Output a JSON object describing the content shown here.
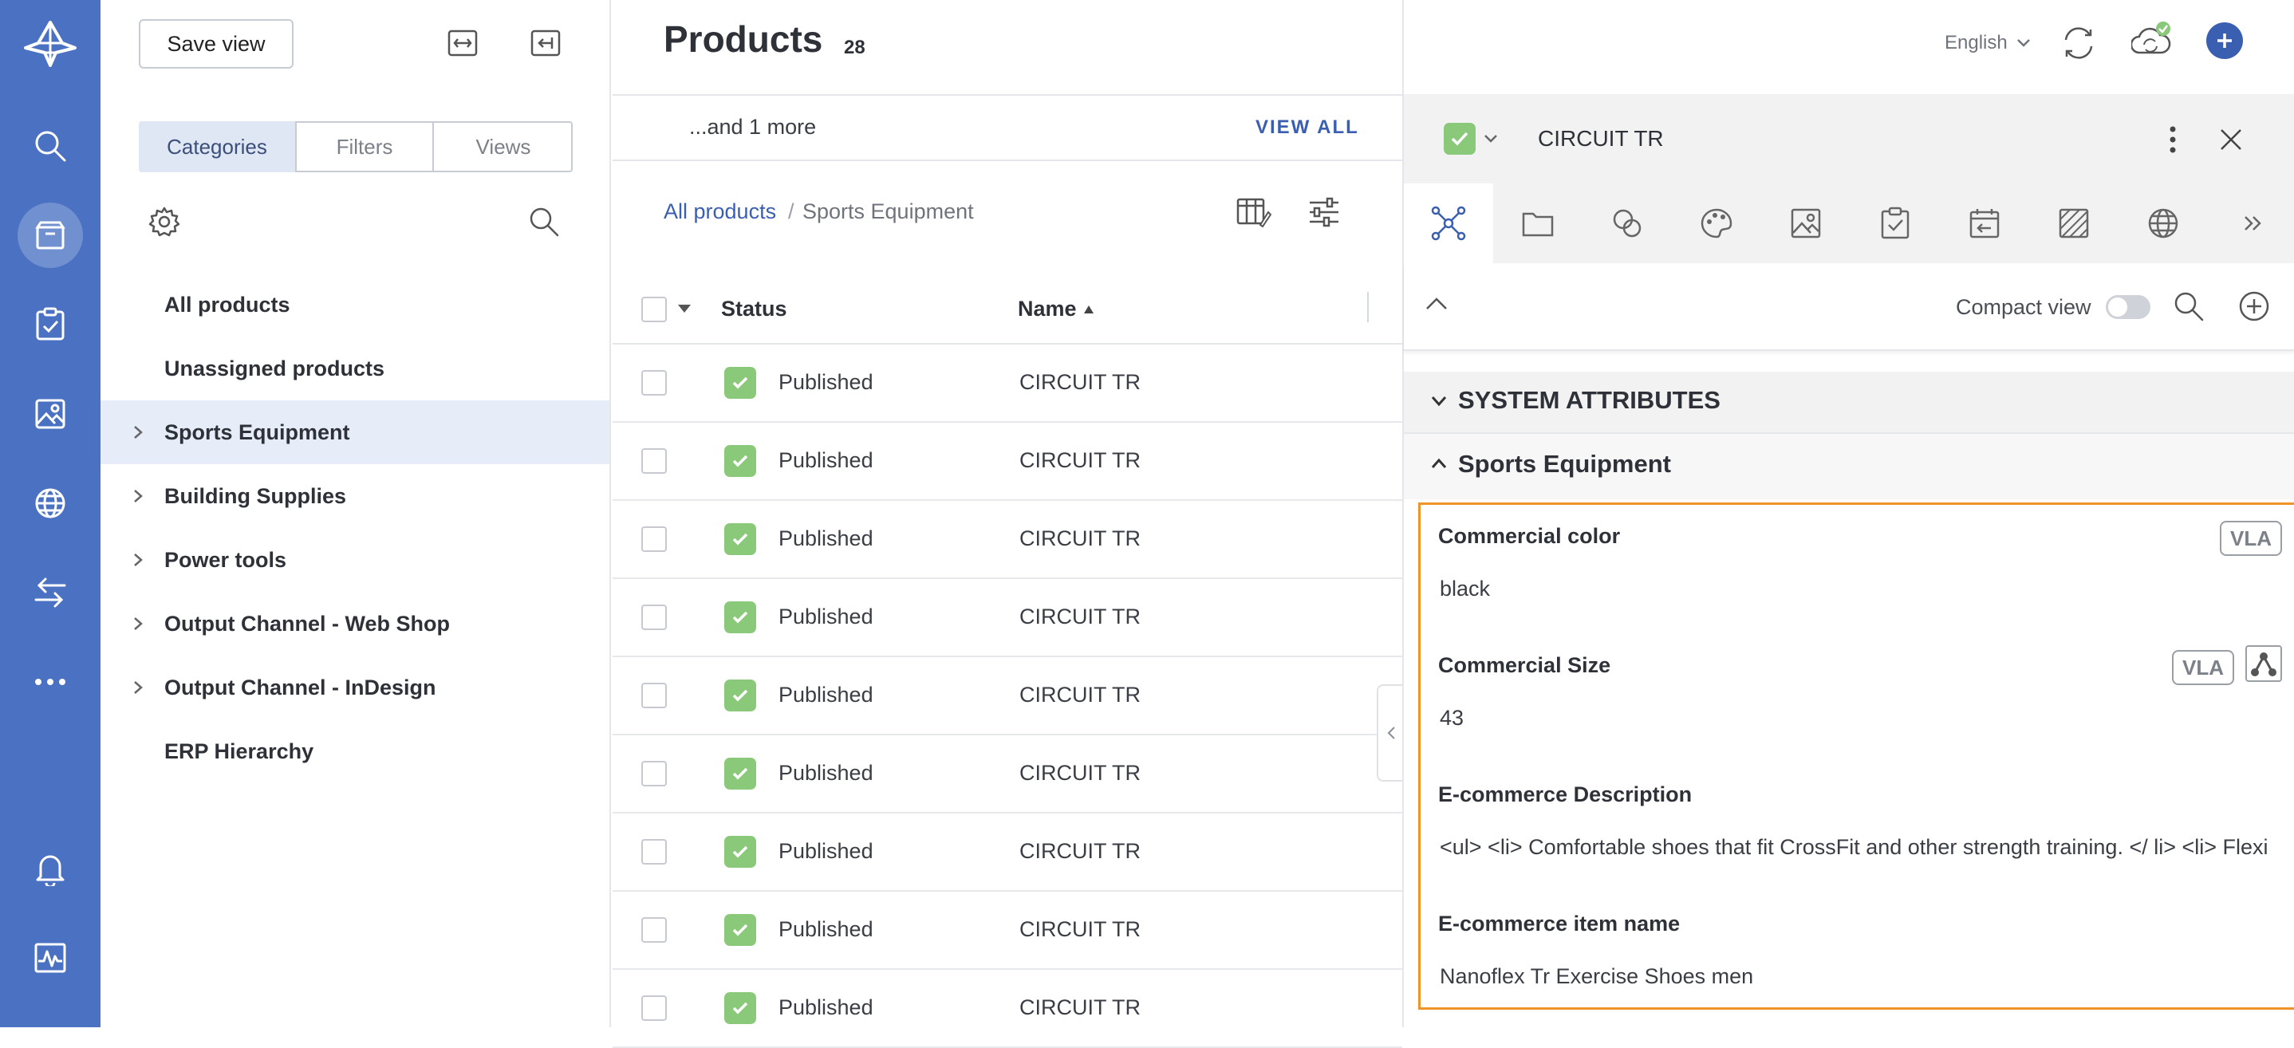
{
  "nav": {
    "items": [
      "logo-icon",
      "search-icon",
      "products-icon",
      "tasks-icon",
      "images-icon",
      "globe-icon",
      "transfer-icon",
      "more-icon",
      "bell-icon",
      "activity-icon"
    ],
    "active": "products-icon"
  },
  "catpanel": {
    "save_view": "Save view",
    "segments": [
      "Categories",
      "Filters",
      "Views"
    ],
    "active_segment": "Categories",
    "items": [
      {
        "label": "All products",
        "expandable": false
      },
      {
        "label": "Unassigned products",
        "expandable": false
      },
      {
        "label": "Sports Equipment",
        "expandable": true,
        "selected": true
      },
      {
        "label": "Building Supplies",
        "expandable": true
      },
      {
        "label": "Power tools",
        "expandable": true
      },
      {
        "label": "Output Channel - Web Shop",
        "expandable": true
      },
      {
        "label": "Output Channel - InDesign",
        "expandable": true
      },
      {
        "label": "ERP Hierarchy",
        "expandable": false
      }
    ]
  },
  "header": {
    "title": "Products",
    "count": "28",
    "language": "English"
  },
  "list": {
    "more_text": "...and 1 more",
    "view_all": "VIEW ALL",
    "breadcrumb_root": "All products",
    "breadcrumb_sep": "/",
    "breadcrumb_current": "Sports Equipment",
    "col_status": "Status",
    "col_name": "Name",
    "rows": [
      {
        "status": "Published",
        "name": "CIRCUIT TR"
      },
      {
        "status": "Published",
        "name": "CIRCUIT TR"
      },
      {
        "status": "Published",
        "name": "CIRCUIT TR"
      },
      {
        "status": "Published",
        "name": "CIRCUIT TR"
      },
      {
        "status": "Published",
        "name": "CIRCUIT TR"
      },
      {
        "status": "Published",
        "name": "CIRCUIT TR"
      },
      {
        "status": "Published",
        "name": "CIRCUIT TR"
      },
      {
        "status": "Published",
        "name": "CIRCUIT TR"
      },
      {
        "status": "Published",
        "name": "CIRCUIT TR"
      }
    ]
  },
  "detail": {
    "title": "CIRCUIT TR",
    "compact_view": "Compact view",
    "compact_view_on": false,
    "section_system": "SYSTEM ATTRIBUTES",
    "section_sports": "Sports Equipment",
    "attributes": [
      {
        "label": "Commercial color",
        "value": "black",
        "badges": [
          "VLA"
        ]
      },
      {
        "label": "Commercial Size",
        "value": "43",
        "badges": [
          "VLA"
        ]
      },
      {
        "label": "E-commerce Description",
        "value": "<ul> <li> Comfortable shoes that fit CrossFit and other strength training. </ li> <li> Flexi",
        "badges": []
      },
      {
        "label": "E-commerce item name",
        "value": "Nanoflex Tr Exercise Shoes men",
        "badges": []
      }
    ]
  },
  "colors": {
    "nav_bg": "#4a71c2",
    "accent": "#3b5fb0",
    "success": "#8bc97a",
    "highlight_border": "#f0942a",
    "selected_row_bg": "#e6edf8"
  }
}
